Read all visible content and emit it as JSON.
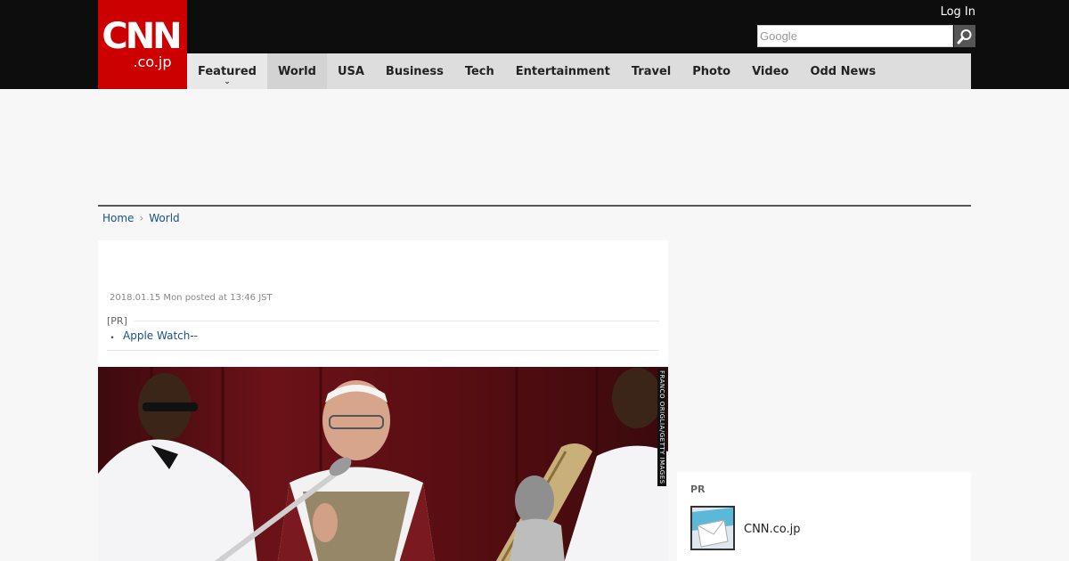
{
  "header": {
    "logo_main": "CNN",
    "logo_sub": ".co.jp",
    "login_label": "Log In",
    "search_placeholder": "Google"
  },
  "nav": {
    "items": [
      {
        "label": "Featured"
      },
      {
        "label": "World"
      },
      {
        "label": "USA"
      },
      {
        "label": "Business"
      },
      {
        "label": "Tech"
      },
      {
        "label": "Entertainment"
      },
      {
        "label": "Travel"
      },
      {
        "label": "Photo"
      },
      {
        "label": "Video"
      },
      {
        "label": "Odd News"
      }
    ]
  },
  "breadcrumb": {
    "home": "Home",
    "current": "World"
  },
  "article": {
    "date": "2018.01.15 Mon posted at 13:46 JST",
    "pr_label": "[PR]",
    "pr_link": "Apple Watch--",
    "photo_credit": "FRANCO ORIGLIA/GETTY IMAGES"
  },
  "sidebar": {
    "pr_title": "PR",
    "pr_item": "CNN.co.jp"
  },
  "colors": {
    "brand_red": "#cc0000",
    "header_bg": "#0d0d0d",
    "nav_bg": "#dddddd",
    "link": "#1a4f8a"
  }
}
